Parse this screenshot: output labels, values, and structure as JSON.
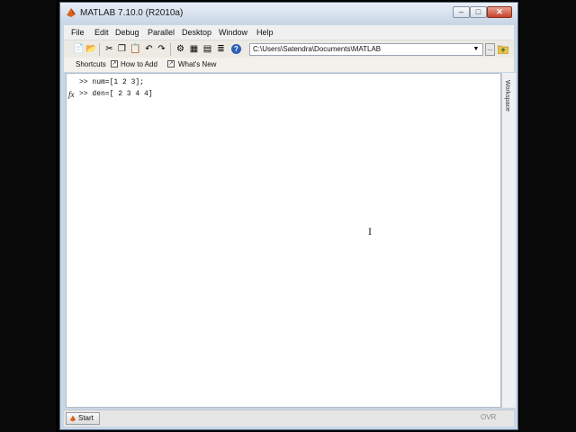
{
  "window": {
    "title": "MATLAB  7.10.0 (R2010a)",
    "minimize_icon": "minimize-icon",
    "maximize_icon": "maximize-icon",
    "close_icon": "close-icon"
  },
  "menubar": {
    "items": [
      "File",
      "Edit",
      "Debug",
      "Parallel",
      "Desktop",
      "Window",
      "Help"
    ]
  },
  "toolbar": {
    "current_folder": "C:\\Users\\Satendra\\Documents\\MATLAB",
    "browse_label": "..."
  },
  "shortcuts": {
    "label": "Shortcuts",
    "items": [
      "How to Add",
      "What's New"
    ]
  },
  "command_window": {
    "lines": [
      ">> num=[1 2 3];",
      ">> den=[ 2 3 4 4]"
    ]
  },
  "workspace": {
    "label": "Workspace"
  },
  "statusbar": {
    "start_label": "Start",
    "ovr_label": "OVR"
  },
  "colors": {
    "title_gradient_top": "#e9eff7",
    "close_button": "#c4432d",
    "window_frame": "#c9d6e6"
  }
}
